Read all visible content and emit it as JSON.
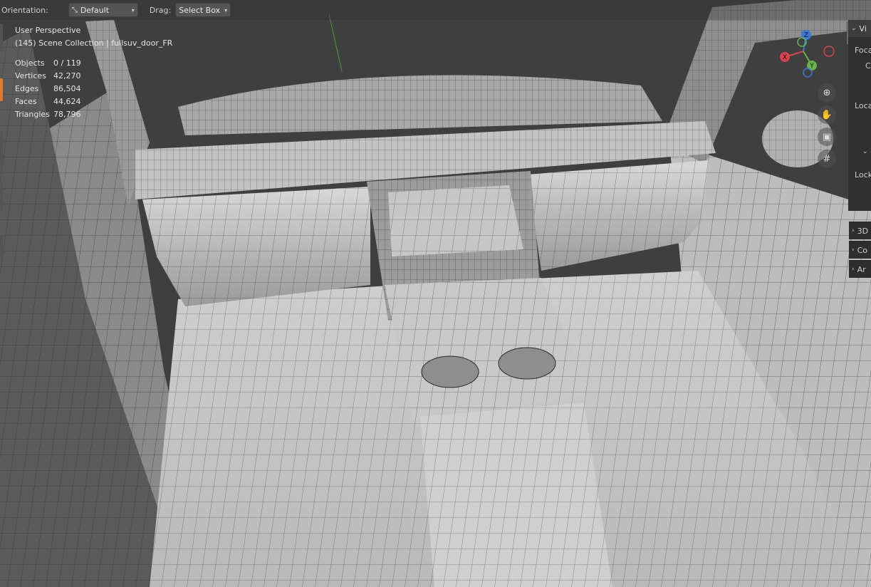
{
  "header": {
    "orientation_label": "Orientation:",
    "orientation_value": "Default",
    "drag_label": "Drag:",
    "drag_value": "Select Box"
  },
  "overlay": {
    "view_name": "User Perspective",
    "collection_path": "(145) Scene Collection | fullsuv_door_FR",
    "stats": [
      {
        "label": "Objects",
        "value": "0 / 119"
      },
      {
        "label": "Vertices",
        "value": "42,270"
      },
      {
        "label": "Edges",
        "value": "86,504"
      },
      {
        "label": "Faces",
        "value": "44,624"
      },
      {
        "label": "Triangles",
        "value": "78,796"
      }
    ]
  },
  "gizmo": {
    "x": "X",
    "y": "Y",
    "z": "Z"
  },
  "npanel": {
    "view_tab": "Vi",
    "focal": "Foca",
    "clip": "C",
    "local": "Loca",
    "lock": "Lock",
    "sections": [
      "3D",
      "Co",
      "Ar"
    ]
  },
  "colors": {
    "x_axis": "#d9424f",
    "y_axis": "#6ab24a",
    "z_axis": "#3c78d8",
    "active_tool": "#e07a2e"
  },
  "icons": [
    "transform-orientation-icon",
    "zoom-icon",
    "hand-pan-icon",
    "camera-icon",
    "grid-ortho-icon"
  ]
}
